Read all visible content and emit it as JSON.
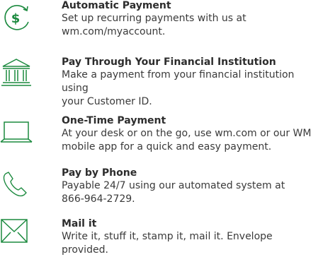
{
  "accent_color": "#1c8a3f",
  "items": [
    {
      "icon": "dollar-refresh-icon",
      "title": "Automatic Payment",
      "desc_line1": "Set up recurring payments with us at",
      "desc_line2": "wm.com/myaccount."
    },
    {
      "icon": "bank-icon",
      "title": "Pay Through Your Financial Institution",
      "desc_line1": "Make a payment from your financial institution using",
      "desc_line2": "your Customer ID."
    },
    {
      "icon": "laptop-icon",
      "title": "One-Time Payment",
      "desc_line1": "At your desk or on the go, use wm.com or our WM",
      "desc_line2": "mobile app for a quick and easy payment."
    },
    {
      "icon": "phone-icon",
      "title": "Pay by Phone",
      "desc_line1": "Payable 24/7 using our automated system at",
      "desc_line2": "866-964-2729."
    },
    {
      "icon": "envelope-icon",
      "title": "Mail it",
      "desc_line1": "Write it, stuff it, stamp it, mail it. Envelope provided.",
      "desc_line2": ""
    }
  ]
}
